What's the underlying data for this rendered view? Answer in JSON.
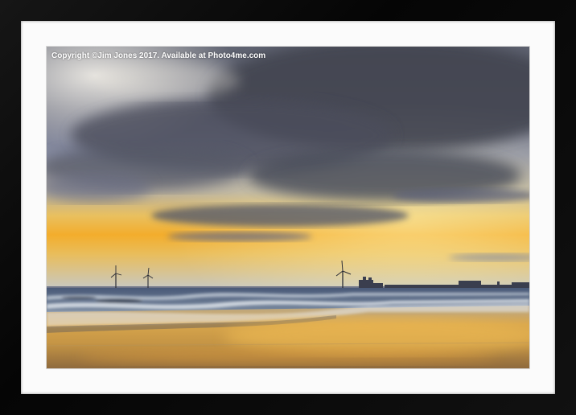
{
  "watermark": {
    "text": "Copyright  ©Jim Jones  2017. Available at Photo4me.com"
  },
  "colors": {
    "frame": "#0b0b0b",
    "mount": "#fbfbfb",
    "sky_storm": "#4a4d58",
    "sky_glow": "#f2b93a",
    "sea": "#5a6a84",
    "sand_reflection": "#e8b048"
  },
  "scene": {
    "subject": "stormy-sunset-beach",
    "turbines": 3
  }
}
